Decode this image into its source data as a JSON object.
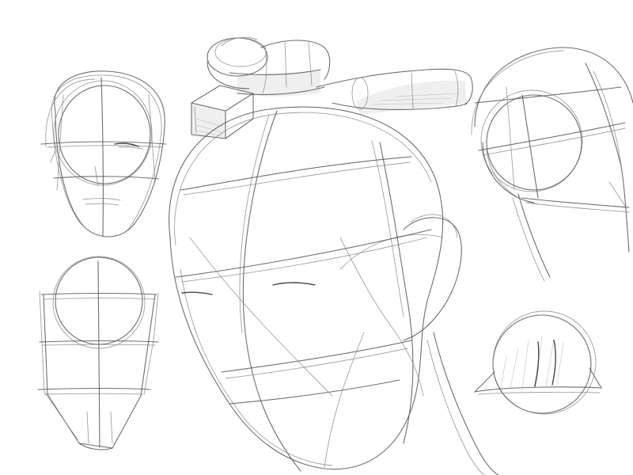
{
  "canvas": {
    "background_color": "#ffffff",
    "stroke_color": "#555555"
  },
  "sketches": [
    {
      "name": "head-front-view-top-left"
    },
    {
      "name": "head-front-view-bottom-left"
    },
    {
      "name": "head-three-quarter-view-center"
    },
    {
      "name": "tube-and-box-study-top-center"
    },
    {
      "name": "head-side-view-top-right"
    },
    {
      "name": "sphere-with-plane-bottom-right"
    }
  ]
}
